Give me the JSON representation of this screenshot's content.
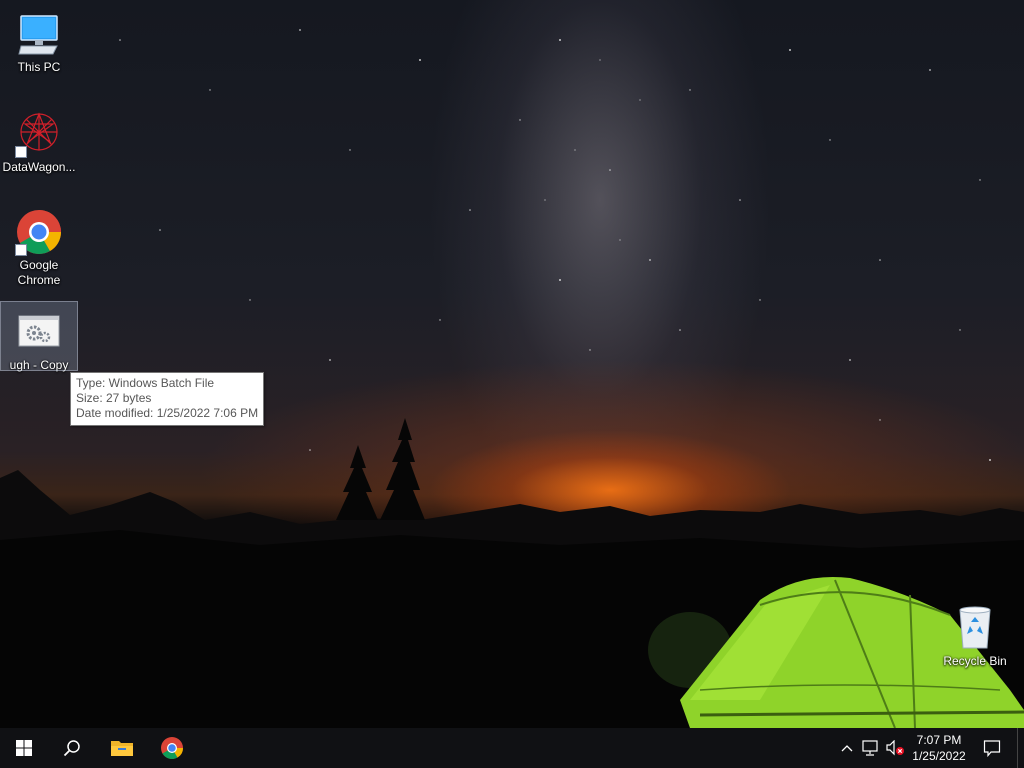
{
  "desktop": {
    "icons": [
      {
        "label": "This PC",
        "icon": "monitor-icon"
      },
      {
        "label": "DataWagon...",
        "icon": "datawagon-app-icon"
      },
      {
        "label": "Google Chrome",
        "icon": "chrome-icon"
      },
      {
        "label": "ugh - Copy",
        "icon": "batch-file-gear-icon"
      },
      {
        "label": "Recycle Bin",
        "icon": "recycle-bin-icon"
      }
    ]
  },
  "tooltip": {
    "type": "Type: Windows Batch File",
    "size": "Size: 27 bytes",
    "date": "Date modified: 1/25/2022 7:06 PM"
  },
  "taskbar": {
    "pinned": [
      "windows-start-icon",
      "search-icon",
      "file-explorer-icon",
      "chrome-icon"
    ],
    "tray": [
      "chevron-up-icon",
      "network-icon",
      "volume-muted-icon",
      "notifications-icon"
    ],
    "time": "7:07 PM",
    "date": "1/25/2022"
  },
  "colors": {
    "taskbar": "#101114",
    "selection": "#a0afc8",
    "tent": "#9be12c",
    "horizon_glow": "#ff7a14"
  }
}
